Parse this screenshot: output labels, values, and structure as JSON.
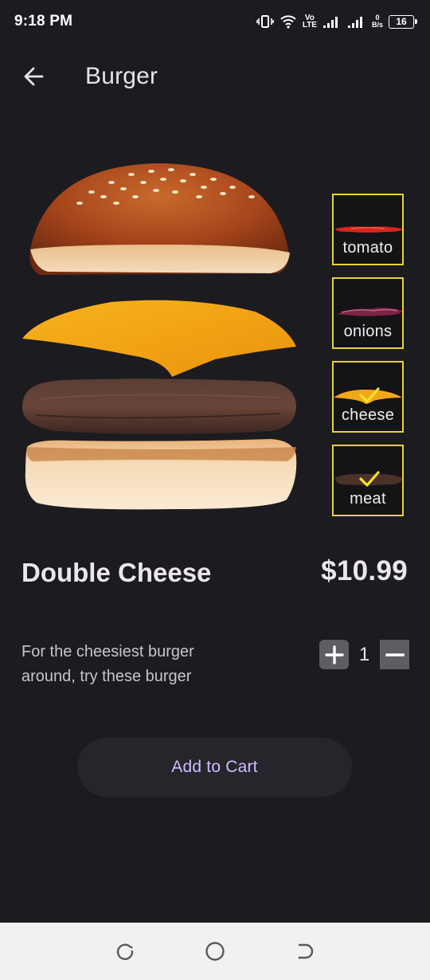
{
  "status_bar": {
    "time": "9:18 PM",
    "network_type_top": "Vo",
    "network_type_bottom": "LTE",
    "data_rate_value": "0",
    "data_rate_unit": "B/s",
    "battery_level": "16"
  },
  "app_bar": {
    "title": "Burger",
    "back_icon": "arrow-back-icon"
  },
  "ingredients": [
    {
      "label": "tomato",
      "selected": false,
      "color": "#d8241c"
    },
    {
      "label": "onions",
      "selected": false,
      "color": "#8c2a4a"
    },
    {
      "label": "cheese",
      "selected": true,
      "color": "#f0a818"
    },
    {
      "label": "meat",
      "selected": true,
      "color": "#4a3228"
    }
  ],
  "product": {
    "name": "Double Cheese",
    "price": "$10.99",
    "description": "For the cheesiest burger around, try these burger",
    "quantity": "1"
  },
  "actions": {
    "add_to_cart_label": "Add to Cart"
  },
  "nav_bar": {
    "icons": [
      "recent-apps-icon",
      "home-icon",
      "back-icon"
    ]
  },
  "colors": {
    "background": "#1c1b20",
    "accent_border": "#e9d13a",
    "button_text": "#d0bcff",
    "check": "#f7e22b"
  }
}
